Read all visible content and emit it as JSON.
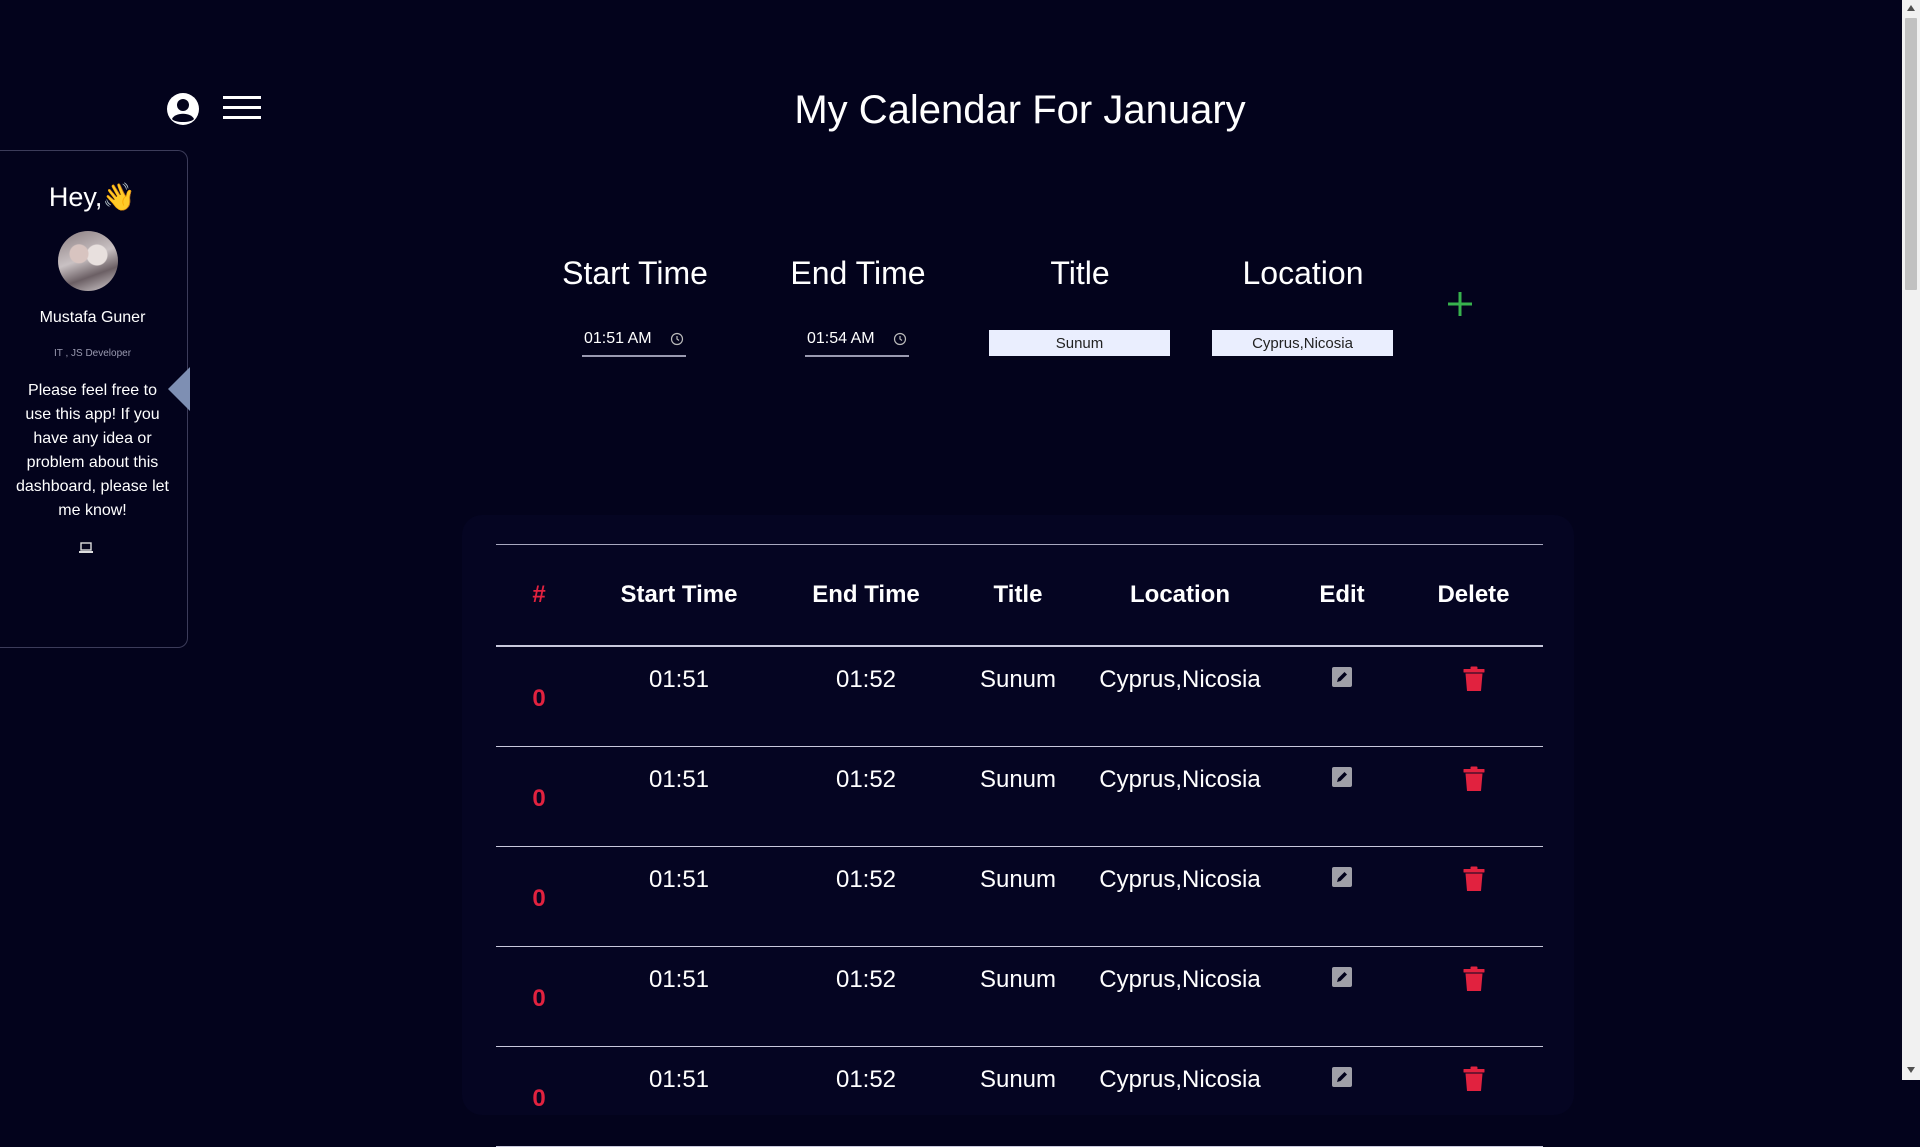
{
  "header": {
    "title": "My Calendar For January",
    "user_icon": "user-circle-icon",
    "menu_icon": "hamburger-menu-icon"
  },
  "sidebar": {
    "greeting": "Hey,👋",
    "user_name": "Mustafa Guner",
    "role": "IT , JS Developer",
    "message": "Please feel free to use this app! If you have any idea or problem about this dashboard, please let me know!",
    "laptop_icon": "laptop-icon",
    "toggle_icon": "caret-left-icon"
  },
  "form": {
    "start_label": "Start Time",
    "end_label": "End Time",
    "title_label": "Title",
    "location_label": "Location",
    "start_value": "01:51 AM",
    "end_value": "01:54 AM",
    "title_value": "Sunum",
    "location_value": "Cyprus,Nicosia",
    "add_icon": "plus-icon"
  },
  "table": {
    "headers": [
      "#",
      "Start Time",
      "End Time",
      "Title",
      "Location",
      "Edit",
      "Delete"
    ],
    "rows": [
      {
        "num": "0",
        "start": "01:51",
        "end": "01:52",
        "title": "Sunum",
        "location": "Cyprus,Nicosia"
      },
      {
        "num": "0",
        "start": "01:51",
        "end": "01:52",
        "title": "Sunum",
        "location": "Cyprus,Nicosia"
      },
      {
        "num": "0",
        "start": "01:51",
        "end": "01:52",
        "title": "Sunum",
        "location": "Cyprus,Nicosia"
      },
      {
        "num": "0",
        "start": "01:51",
        "end": "01:52",
        "title": "Sunum",
        "location": "Cyprus,Nicosia"
      },
      {
        "num": "0",
        "start": "01:51",
        "end": "01:52",
        "title": "Sunum",
        "location": "Cyprus,Nicosia"
      }
    ]
  },
  "colors": {
    "background": "#03031c",
    "accent_red": "#e1223f",
    "add_green": "#37b24d"
  }
}
